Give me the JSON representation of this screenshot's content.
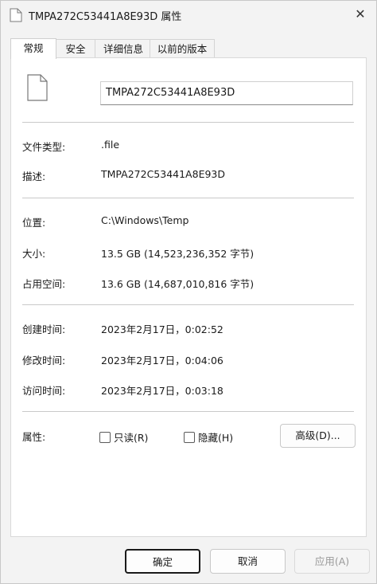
{
  "window": {
    "title": "TMPA272C53441A8E93D 属性",
    "close_glyph": "✕"
  },
  "tabs": [
    {
      "label": "常规",
      "active": true
    },
    {
      "label": "安全",
      "active": false
    },
    {
      "label": "详细信息",
      "active": false
    },
    {
      "label": "以前的版本",
      "active": false
    }
  ],
  "general": {
    "file_name": "TMPA272C53441A8E93D",
    "file_type_label": "文件类型:",
    "file_type_value": ".file",
    "description_label": "描述:",
    "description_value": "TMPA272C53441A8E93D",
    "location_label": "位置:",
    "location_value": "C:\\Windows\\Temp",
    "size_label": "大小:",
    "size_value": "13.5 GB (14,523,236,352 字节)",
    "size_on_disk_label": "占用空间:",
    "size_on_disk_value": "13.6 GB (14,687,010,816 字节)",
    "created_label": "创建时间:",
    "created_value": "2023年2月17日，0:02:52",
    "modified_label": "修改时间:",
    "modified_value": "2023年2月17日，0:04:06",
    "accessed_label": "访问时间:",
    "accessed_value": "2023年2月17日，0:03:18",
    "attributes_label": "属性:",
    "readonly_label": "只读(R)",
    "readonly_checked": false,
    "hidden_label": "隐藏(H)",
    "hidden_checked": false,
    "advanced_button": "高级(D)..."
  },
  "buttons": {
    "ok": "确定",
    "cancel": "取消",
    "apply": "应用(A)"
  }
}
